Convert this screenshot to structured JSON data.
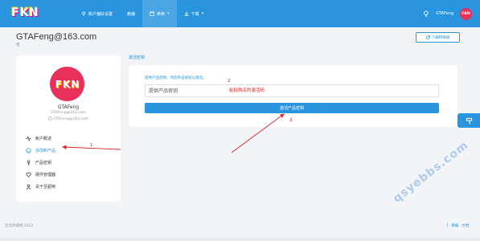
{
  "header": {
    "logo_letters": [
      "F",
      "K",
      "N"
    ],
    "nav": [
      {
        "label": "账户偏好设置"
      },
      {
        "label": "教编"
      },
      {
        "label": "卖卖"
      },
      {
        "label": "下载"
      }
    ],
    "username": "GTAFeng",
    "avatar_text": "FKN",
    "bg_color": "#2a95df"
  },
  "page": {
    "title": "GTAFeng@163.com",
    "subtitle": "用",
    "download_button": "下载特殊版"
  },
  "profile": {
    "avatar_letters": [
      "F",
      "K",
      "N"
    ],
    "name": "GTAFeng",
    "email": "GTAFeng@163.com",
    "email_secondary": "GTAFeng@163.com",
    "menu": [
      {
        "label": "帐户概述",
        "icon": "activity-icon"
      },
      {
        "label": "添加新产品",
        "icon": "smiley-icon",
        "active": true
      },
      {
        "label": "产品密钥",
        "icon": "key-icon"
      },
      {
        "label": "硬件管理器",
        "icon": "heart-icon"
      },
      {
        "label": "关于至超特",
        "icon": "user-icon"
      }
    ]
  },
  "activation": {
    "section_label": "激活密钥",
    "hint": "提供产品密钥，然后单击按钮以激活。",
    "input_placeholder": "提供产品密钥",
    "button": "激活产品密钥"
  },
  "annotations": {
    "step1": "1",
    "step2": "2",
    "step3": "3",
    "paste_note": "粘贴购买的激活码"
  },
  "footer": {
    "copyright": "至云终端端 2022",
    "links": [
      "J",
      "教编",
      "文档"
    ]
  },
  "watermark": "qsyebbs.com",
  "colors": {
    "accent": "#2a95df",
    "annotation": "#e02020",
    "avatar": "#e8305b"
  }
}
